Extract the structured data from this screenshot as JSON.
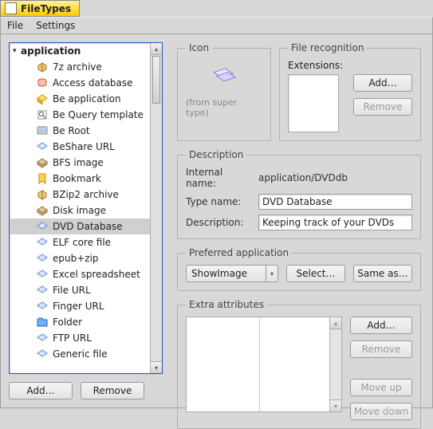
{
  "window": {
    "title": "FileTypes"
  },
  "menu": {
    "file": "File",
    "settings": "Settings"
  },
  "tree": {
    "parent": "application",
    "items": [
      {
        "label": "7z archive",
        "icon": "pkg"
      },
      {
        "label": "Access database",
        "icon": "db"
      },
      {
        "label": "Be application",
        "icon": "app"
      },
      {
        "label": "Be Query template",
        "icon": "query"
      },
      {
        "label": "Be Root",
        "icon": "root"
      },
      {
        "label": "BeShare URL",
        "icon": "generic"
      },
      {
        "label": "BFS image",
        "icon": "disk"
      },
      {
        "label": "Bookmark",
        "icon": "bookmark"
      },
      {
        "label": "BZip2 archive",
        "icon": "pkg"
      },
      {
        "label": "Disk image",
        "icon": "disk"
      },
      {
        "label": "DVD Database",
        "icon": "generic",
        "selected": true
      },
      {
        "label": "ELF core file",
        "icon": "generic"
      },
      {
        "label": "epub+zip",
        "icon": "generic"
      },
      {
        "label": "Excel spreadsheet",
        "icon": "generic"
      },
      {
        "label": "File URL",
        "icon": "generic"
      },
      {
        "label": "Finger URL",
        "icon": "generic"
      },
      {
        "label": "Folder",
        "icon": "folder"
      },
      {
        "label": "FTP URL",
        "icon": "generic"
      },
      {
        "label": "Generic file",
        "icon": "generic"
      }
    ]
  },
  "left_buttons": {
    "add": "Add…",
    "remove": "Remove"
  },
  "icon_group": {
    "title": "Icon",
    "from_super": "(from super type)"
  },
  "recog": {
    "title": "File recognition",
    "ext_label": "Extensions:",
    "add": "Add…",
    "remove": "Remove"
  },
  "desc": {
    "title": "Description",
    "internal_label": "Internal name:",
    "internal_value": "application/DVDdb",
    "type_label": "Type name:",
    "type_value": "DVD Database",
    "desc_label": "Description:",
    "desc_value": "Keeping track of your DVDs"
  },
  "pref": {
    "title": "Preferred application",
    "app": "ShowImage",
    "select": "Select…",
    "same_as": "Same as…"
  },
  "extra": {
    "title": "Extra attributes",
    "add": "Add…",
    "remove": "Remove",
    "move_up": "Move up",
    "move_down": "Move down"
  }
}
